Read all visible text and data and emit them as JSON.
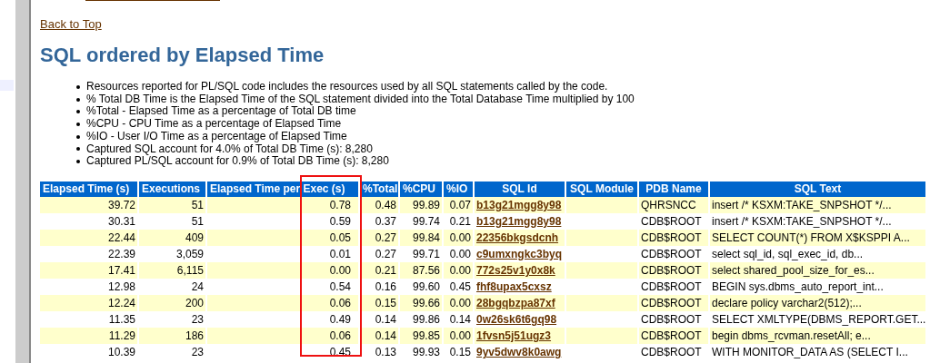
{
  "back_link": "Back to Top",
  "title": "SQL ordered by Elapsed Time",
  "notes": [
    "Resources reported for PL/SQL code includes the resources used by all SQL statements called by the code.",
    "% Total DB Time is the Elapsed Time of the SQL statement divided into the Total Database Time multiplied by 100",
    "%Total - Elapsed Time as a percentage of Total DB time",
    "%CPU - CPU Time as a percentage of Elapsed Time",
    "%IO - User I/O Time as a percentage of Elapsed Time",
    "Captured SQL account for 4.0% of Total DB Time (s): 8,280",
    "Captured PL/SQL account for 0.9% of Total DB Time (s): 8,280"
  ],
  "table": {
    "columns": [
      "Elapsed Time (s)",
      "Executions",
      "Elapsed Time per Exec (s)",
      "%Total",
      "%CPU",
      "%IO",
      "SQL Id",
      "SQL Module",
      "PDB Name",
      "SQL Text"
    ],
    "rows": [
      [
        "39.72",
        "51",
        "0.78",
        "0.48",
        "99.89",
        "0.07",
        "b13g21mgg8y98",
        "",
        "QHRSNCC",
        "insert /* KSXM:TAKE_SNPSHOT */..."
      ],
      [
        "30.31",
        "51",
        "0.59",
        "0.37",
        "99.74",
        "0.21",
        "b13g21mgg8y98",
        "",
        "CDB$ROOT",
        "insert /* KSXM:TAKE_SNPSHOT */..."
      ],
      [
        "22.44",
        "409",
        "0.05",
        "0.27",
        "99.84",
        "0.00",
        "22356bkgsdcnh",
        "",
        "CDB$ROOT",
        "SELECT COUNT(*) FROM X$KSPPI A..."
      ],
      [
        "22.39",
        "3,059",
        "0.01",
        "0.27",
        "99.71",
        "0.00",
        "c9umxngkc3byq",
        "",
        "CDB$ROOT",
        "select sql_id, sql_exec_id, db..."
      ],
      [
        "17.41",
        "6,115",
        "0.00",
        "0.21",
        "87.56",
        "0.00",
        "772s25v1y0x8k",
        "",
        "CDB$ROOT",
        "select shared_pool_size_for_es..."
      ],
      [
        "12.98",
        "24",
        "0.54",
        "0.16",
        "99.60",
        "0.45",
        "fhf8upax5cxsz",
        "",
        "CDB$ROOT",
        "BEGIN sys.dbms_auto_report_int..."
      ],
      [
        "12.24",
        "200",
        "0.06",
        "0.15",
        "99.66",
        "0.00",
        "28bgqbzpa87xf",
        "",
        "CDB$ROOT",
        "declare policy varchar2(512);..."
      ],
      [
        "11.35",
        "23",
        "0.49",
        "0.14",
        "99.86",
        "0.14",
        "0w26sk6t6gq98",
        "",
        "CDB$ROOT",
        "SELECT XMLTYPE(DBMS_REPORT.GET..."
      ],
      [
        "11.29",
        "186",
        "0.06",
        "0.14",
        "99.85",
        "0.00",
        "1fvsn5j51ugz3",
        "",
        "CDB$ROOT",
        "begin dbms_rcvman.resetAll; e..."
      ],
      [
        "10.39",
        "23",
        "0.45",
        "0.13",
        "99.93",
        "0.15",
        "9yv5dwv8k0awg",
        "",
        "CDB$ROOT",
        "WITH MONITOR_DATA AS (SELECT I..."
      ]
    ]
  }
}
